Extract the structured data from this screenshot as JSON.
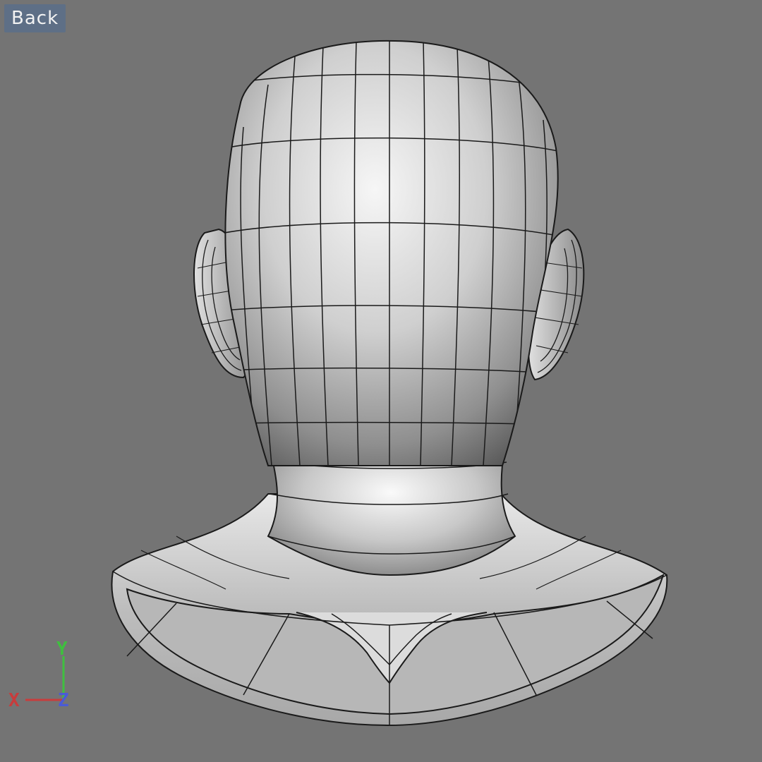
{
  "viewport": {
    "label": "Back",
    "background_color": "#747474"
  },
  "model": {
    "name": "head-bust-mesh",
    "shading": "smooth-with-wireframe",
    "wire_color": "#1a1a1a"
  },
  "axis_gizmo": {
    "x_label": "X",
    "y_label": "Y",
    "z_label": "Z",
    "x_color": "#c83c3c",
    "y_color": "#3fbf3f",
    "z_color": "#4a5bd6"
  }
}
